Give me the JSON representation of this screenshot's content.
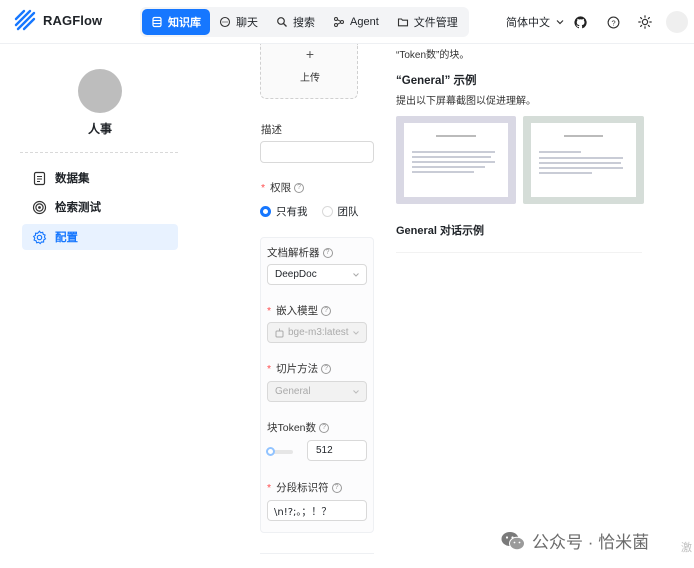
{
  "app": {
    "name": "RAGFlow"
  },
  "nav": [
    {
      "label": "知识库",
      "icon": "database-icon",
      "active": true
    },
    {
      "label": "聊天",
      "icon": "chat-bubble-icon",
      "active": false
    },
    {
      "label": "搜索",
      "icon": "search-icon",
      "active": false
    },
    {
      "label": "Agent",
      "icon": "agent-graph-icon",
      "active": false
    },
    {
      "label": "文件管理",
      "icon": "folder-icon",
      "active": false
    }
  ],
  "header": {
    "language": "简体中文"
  },
  "sidebar": {
    "kb_name": "人事",
    "items": [
      {
        "label": "数据集",
        "icon": "document-icon",
        "active": false
      },
      {
        "label": "检索测试",
        "icon": "target-icon",
        "active": false
      },
      {
        "label": "配置",
        "icon": "gear-icon",
        "active": true
      }
    ]
  },
  "form": {
    "upload_label": "上传",
    "upload_plus": "+",
    "description_label": "描述",
    "permission_label": "权限",
    "permission_options": [
      "只有我",
      "团队"
    ],
    "permission_selected": "只有我",
    "parser_label": "文档解析器",
    "parser_value": "DeepDoc",
    "embedding_label": "嵌入模型",
    "embedding_value": "bge-m3:latest",
    "chunk_method_label": "切片方法",
    "chunk_method_value": "General",
    "chunk_token_label": "块Token数",
    "chunk_token_value": "512",
    "delimiter_label": "分段标识符",
    "delimiter_value": "\\n!?;。；！？"
  },
  "preview": {
    "truncated_text": "“Token数”的块。",
    "example_title": "“General” 示例",
    "example_desc": "提出以下屏幕截图以促进理解。",
    "dialog_title": "General 对话示例"
  },
  "watermark": {
    "text": "公众号 · 恰米菌",
    "corner": "激"
  },
  "colors": {
    "accent": "#1677ff",
    "required": "#ff4d4f",
    "active_bg": "#e8f2ff"
  }
}
